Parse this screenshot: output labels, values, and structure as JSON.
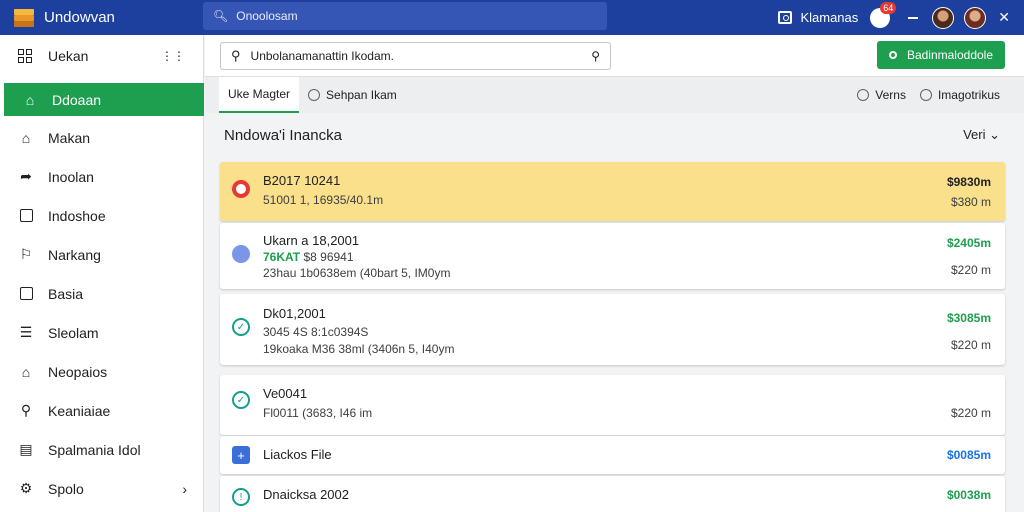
{
  "app": {
    "name": "Undowvan"
  },
  "topbar": {
    "search_text": "Onoolosam",
    "account_label": "Klamanas",
    "notification_count": "64"
  },
  "sidebar": {
    "header": "Uekan",
    "items": [
      {
        "label": "Ddoaan",
        "icon": "home-icon",
        "active": true
      },
      {
        "label": "Makan",
        "icon": "house-outline-icon"
      },
      {
        "label": "Inoolan",
        "icon": "send-icon"
      },
      {
        "label": "Indoshoe",
        "icon": "edit-box-icon"
      },
      {
        "label": "Narkang",
        "icon": "tag-icon"
      },
      {
        "label": "Basia",
        "icon": "document-icon"
      },
      {
        "label": "Sleolam",
        "icon": "list-icon"
      },
      {
        "label": "Neopaios",
        "icon": "house-icon"
      },
      {
        "label": "Keaniaiae",
        "icon": "search-person-icon"
      },
      {
        "label": "Spalmania Idol",
        "icon": "chart-icon"
      },
      {
        "label": "Spolo",
        "icon": "settings-icon"
      }
    ]
  },
  "main": {
    "search_text": "Unbolanamanattin Ikodam.",
    "action_label": "Badinmaloddole",
    "tabs": [
      {
        "label": "Uke Magter",
        "active": true
      },
      {
        "label": "Sehpan Ikam"
      }
    ],
    "filters": [
      "Verns",
      "Imagotrikus"
    ],
    "section_title": "Nndowa'i Inancka",
    "view_label": "Veri",
    "entries": [
      {
        "title": "B2017 10241",
        "line2": "51001 1, 16935/40.1m",
        "line3": "",
        "amount": "$9830m",
        "sub": "$380 m",
        "highlight": true
      },
      {
        "title": "Ukarn a 18,2001",
        "tag": "76KAT",
        "line2": "$8 96941",
        "line3": "23hau 1b0638em (40bart 5, IM0ym",
        "amount": "$2405m",
        "sub": "$220 m"
      },
      {
        "title": "Dk01,2001",
        "line2": "3045 4S 8:1c0394S",
        "line3": "19koaka M36 38ml (3406n 5, I40ym",
        "amount": "$3085m",
        "sub": "$220 m"
      },
      {
        "title": "Ve0041",
        "line2": "Fl0011 (3683, I46 im",
        "line3": "",
        "amount": "",
        "sub": "$220 m"
      },
      {
        "title": "Liackos File",
        "line2": "",
        "line3": "",
        "amount": "$0085m",
        "sub": ""
      },
      {
        "title": "Dnaicksa 2002",
        "line2": "",
        "line3": "",
        "amount": "$0038m",
        "sub": ""
      }
    ]
  }
}
